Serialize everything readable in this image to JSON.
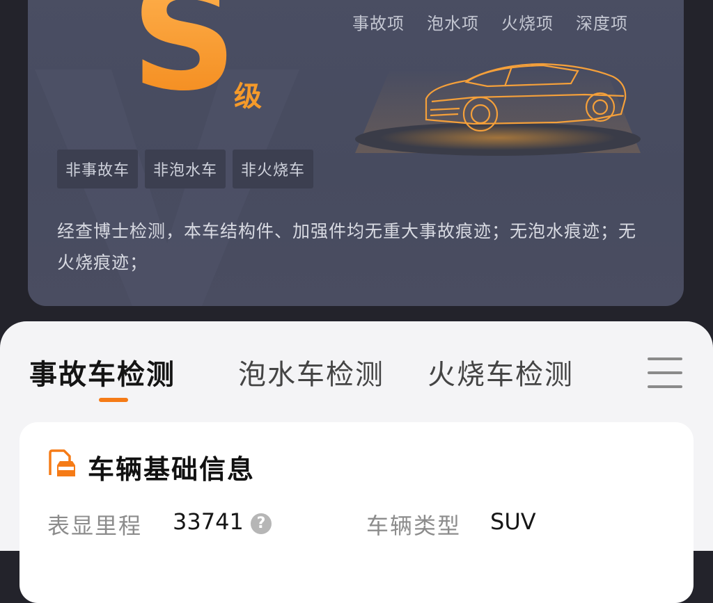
{
  "grade": {
    "letter": "S",
    "suffix": "级"
  },
  "category_tabs": [
    "事故项",
    "泡水项",
    "火烧项",
    "深度项"
  ],
  "tags": [
    "非事故车",
    "非泡水车",
    "非火烧车"
  ],
  "description": "经查博士检测，本车结构件、加强件均无重大事故痕迹；无泡水痕迹；无火烧痕迹；",
  "tabs": [
    {
      "label": "事故车检测",
      "active": true
    },
    {
      "label": "泡水车检测",
      "active": false
    },
    {
      "label": "火烧车检测",
      "active": false
    }
  ],
  "vehicle_info": {
    "title": "车辆基础信息",
    "fields": [
      {
        "label": "表显里程",
        "value": "33741"
      },
      {
        "label": "车辆类型",
        "value": "SUV"
      }
    ]
  },
  "colors": {
    "accent": "#f57b17",
    "hero_bg": "#474b5f",
    "page_bg": "#23232b"
  },
  "icons": [
    "car-document-icon",
    "help-icon",
    "menu-icon",
    "car-illustration"
  ]
}
